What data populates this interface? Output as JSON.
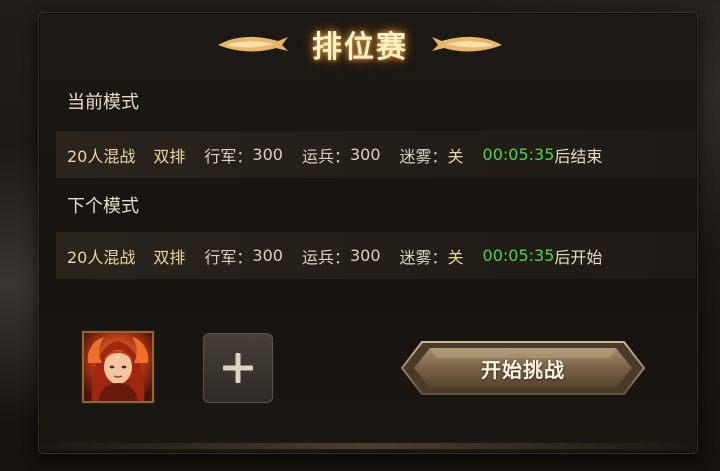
{
  "title": "排位赛",
  "current": {
    "heading": "当前模式",
    "mode": "20人混战",
    "team": "双排",
    "march_label": "行军：",
    "march_value": "300",
    "transport_label": "运兵：",
    "transport_value": "300",
    "fog_label": "迷雾：",
    "fog_value": "关",
    "time": "00:05:35",
    "time_suffix": "后结束"
  },
  "next": {
    "heading": "下个模式",
    "mode": "20人混战",
    "team": "双排",
    "march_label": "行军：",
    "march_value": "300",
    "transport_label": "运兵：",
    "transport_value": "300",
    "fog_label": "迷雾：",
    "fog_value": "关",
    "time": "00:05:35",
    "time_suffix": "后开始"
  },
  "start_button": "开始挑战",
  "icons": {
    "add": "plus-icon",
    "avatar": "hero-portrait",
    "wings": "gold-wing-ornament"
  },
  "colors": {
    "time_green": "#4fd44a",
    "gold_text": "#e9d79e",
    "title_glow": "#e3a24a"
  }
}
